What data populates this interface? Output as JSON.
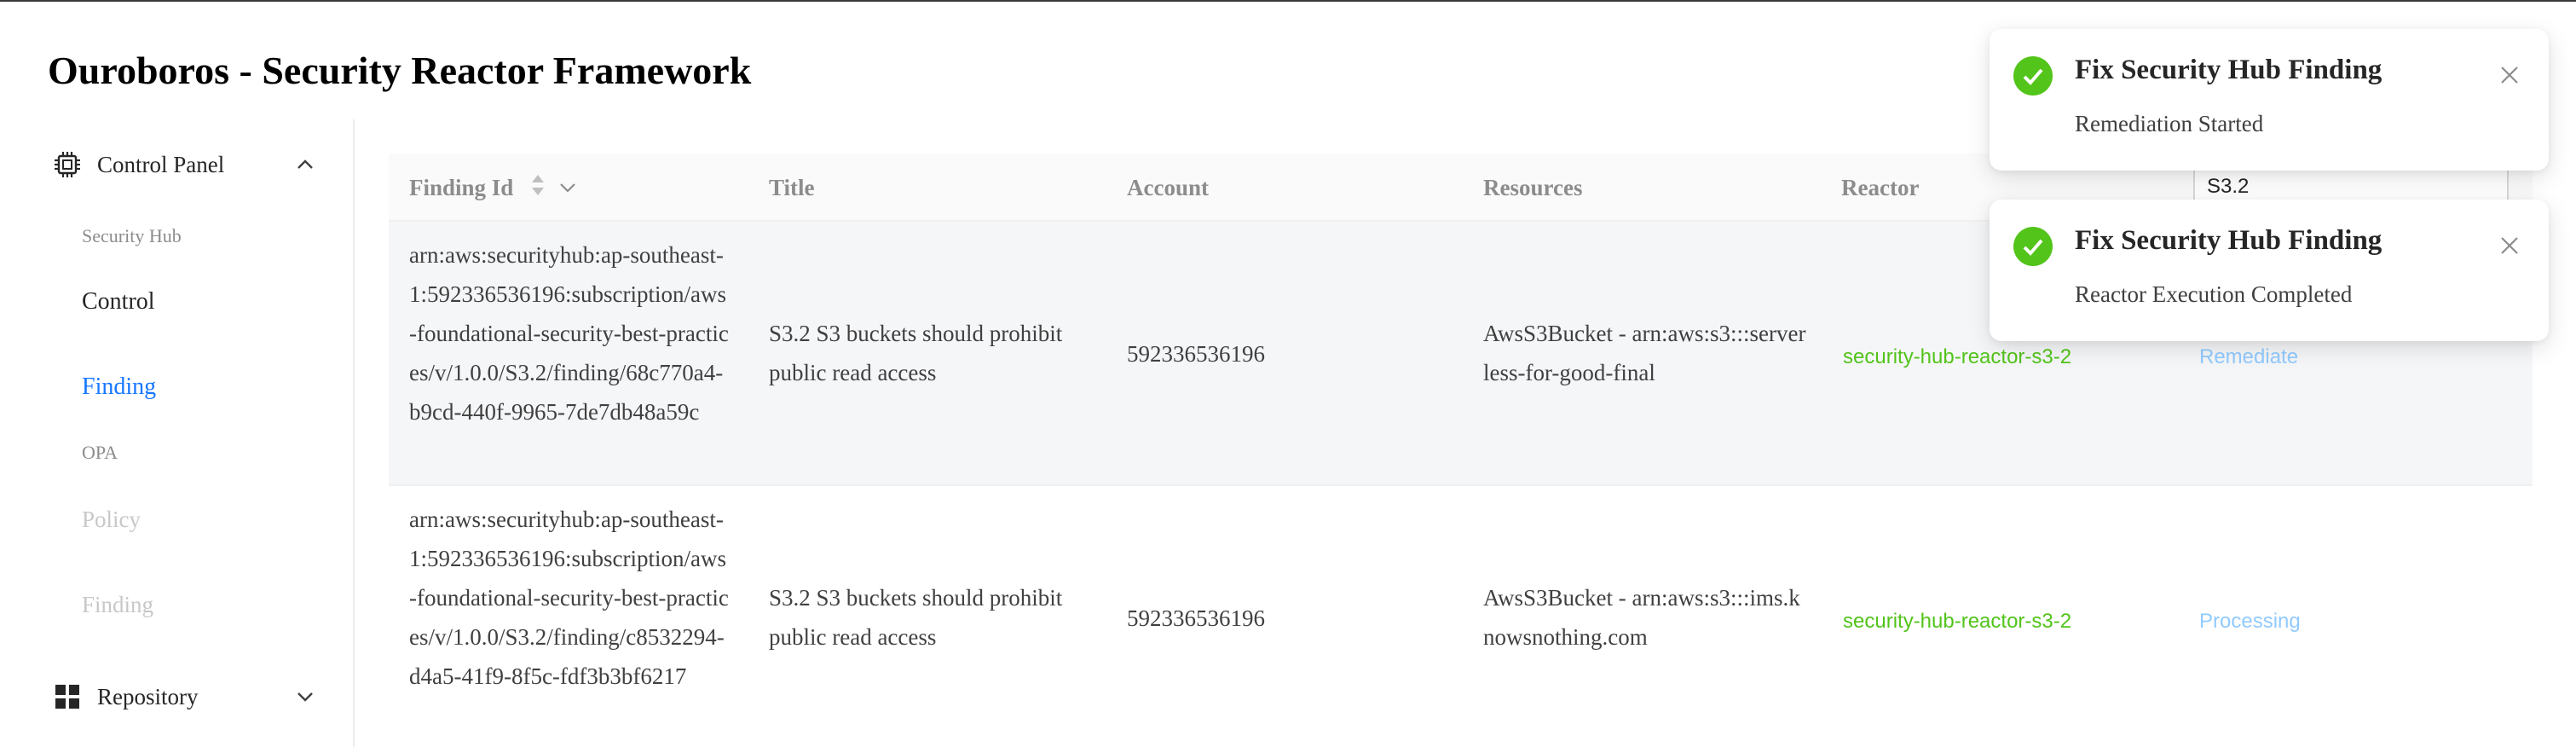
{
  "app": {
    "title": "Ouroboros - Security Reactor Framework"
  },
  "sidebar": {
    "control_panel": "Control Panel",
    "items": [
      {
        "label": "Security Hub"
      },
      {
        "label": "Control"
      },
      {
        "label": "Finding"
      },
      {
        "label": "OPA"
      },
      {
        "label": "Policy"
      },
      {
        "label": "Finding"
      }
    ],
    "repository": "Repository"
  },
  "table": {
    "columns": [
      "Finding Id",
      "Title",
      "Account",
      "Resources",
      "Reactor"
    ],
    "filter_value": "S3.2",
    "rows": [
      {
        "finding_id": "arn:aws:securityhub:ap-southeast-1:592336536196:subscription/aws-foundational-security-best-practices/v/1.0.0/S3.2/finding/68c770a4-b9cd-440f-9965-7de7db48a59c",
        "title": "S3.2 S3 buckets should prohibit public read access",
        "account": "592336536196",
        "resources": "AwsS3Bucket - arn:aws:s3:::serverless-for-good-final",
        "reactor": "security-hub-reactor-s3-2",
        "action": "Remediate"
      },
      {
        "finding_id": "arn:aws:securityhub:ap-southeast-1:592336536196:subscription/aws-foundational-security-best-practices/v/1.0.0/S3.2/finding/c8532294-d4a5-41f9-8f5c-fdf3b3bf6217",
        "title": "S3.2 S3 buckets should prohibit public read access",
        "account": "592336536196",
        "resources": "AwsS3Bucket - arn:aws:s3:::ims.knowsnothing.com",
        "reactor": "security-hub-reactor-s3-2",
        "action": "Processing"
      }
    ]
  },
  "notifications": [
    {
      "title": "Fix Security Hub Finding",
      "description": "Remediation Started"
    },
    {
      "title": "Fix Security Hub Finding",
      "description": "Reactor Execution Completed"
    }
  ],
  "colors": {
    "accent": "#1677ff",
    "success": "#52c41a",
    "action_link": "#91caff",
    "disabled_text": "#c8c8c8"
  },
  "icons": [
    "chip-icon",
    "chevron-up-icon",
    "grid-icon",
    "chevron-down-icon",
    "sort-icon",
    "filter-chevron-icon",
    "check-circle-icon",
    "close-icon"
  ]
}
